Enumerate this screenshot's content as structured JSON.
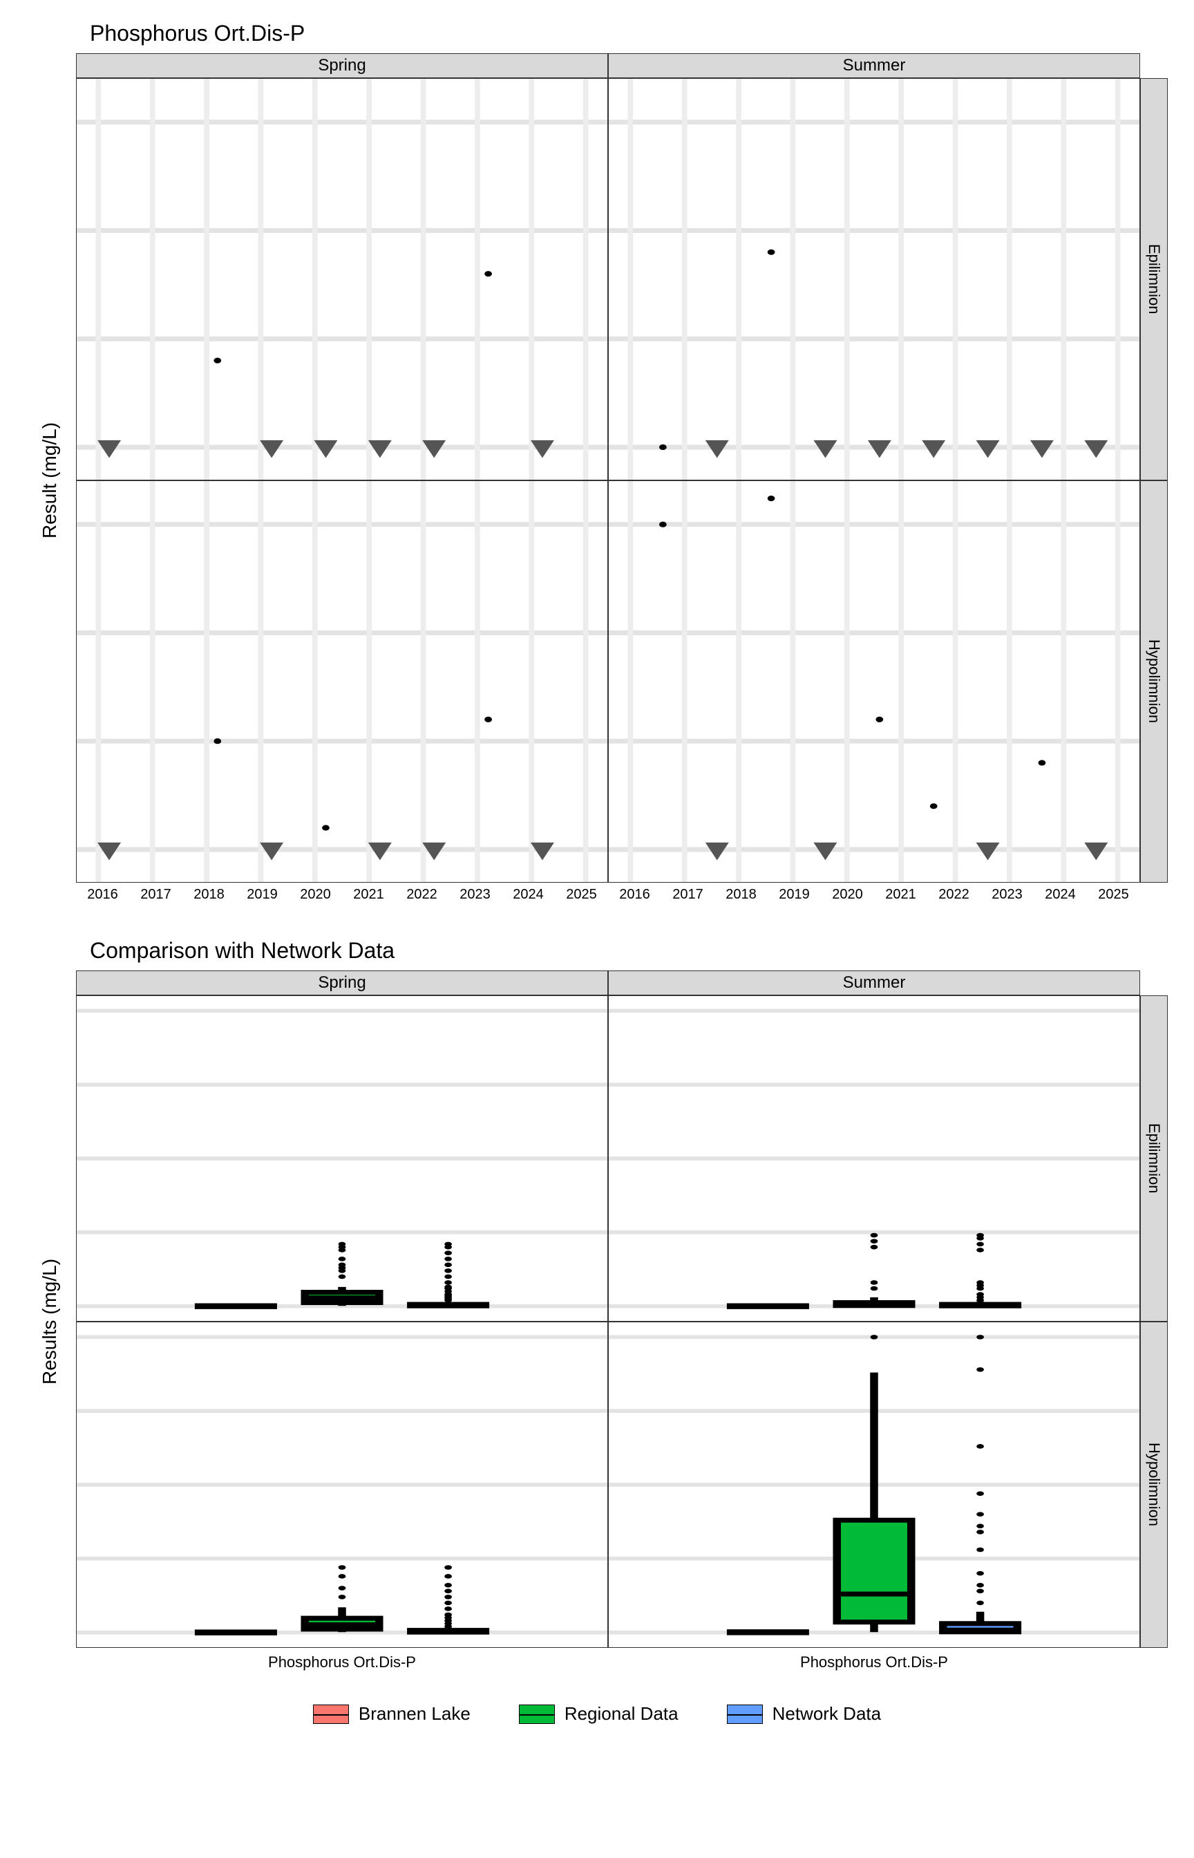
{
  "chart1": {
    "title": "Phosphorus Ort.Dis-P",
    "ylabel": "Result (mg/L)",
    "cols": [
      "Spring",
      "Summer"
    ],
    "rows": [
      "Epilimnion",
      "Hypolimnion"
    ],
    "x_ticks": [
      "2016",
      "2017",
      "2018",
      "2019",
      "2020",
      "2021",
      "2022",
      "2023",
      "2024",
      "2025"
    ],
    "y_ticks": [
      0.001,
      0.0015,
      0.002,
      0.0025
    ],
    "y_range": [
      0.00085,
      0.0027
    ]
  },
  "chart2": {
    "title": "Comparison with Network Data",
    "ylabel": "Results (mg/L)",
    "cols": [
      "Spring",
      "Summer"
    ],
    "rows": [
      "Epilimnion",
      "Hypolimnion"
    ],
    "x_category": "Phosphorus Ort.Dis-P",
    "y_ticks": [
      0.0,
      0.25,
      0.5,
      0.75,
      1.0
    ],
    "y_range": [
      -0.05,
      1.05
    ]
  },
  "legend": {
    "items": [
      {
        "label": "Brannen Lake",
        "color": "#F8766D"
      },
      {
        "label": "Regional Data",
        "color": "#00BA38"
      },
      {
        "label": "Network Data",
        "color": "#619CFF"
      }
    ]
  },
  "chart_data": [
    {
      "type": "scatter",
      "title": "Phosphorus Ort.Dis-P",
      "xlabel": "",
      "ylabel": "Result (mg/L)",
      "ylim": [
        0.00085,
        0.0027
      ],
      "facets_col": [
        "Spring",
        "Summer"
      ],
      "facets_row": [
        "Epilimnion",
        "Hypolimnion"
      ],
      "panels": {
        "Spring|Epilimnion": {
          "dots": [
            {
              "x": 2018.2,
              "y": 0.0014
            },
            {
              "x": 2023.2,
              "y": 0.0018
            }
          ],
          "triangles": [
            {
              "x": 2016.2,
              "y": 0.001
            },
            {
              "x": 2019.2,
              "y": 0.001
            },
            {
              "x": 2020.2,
              "y": 0.001
            },
            {
              "x": 2021.2,
              "y": 0.001
            },
            {
              "x": 2022.2,
              "y": 0.001
            },
            {
              "x": 2024.2,
              "y": 0.001
            }
          ]
        },
        "Summer|Epilimnion": {
          "dots": [
            {
              "x": 2016.6,
              "y": 0.001
            },
            {
              "x": 2018.6,
              "y": 0.0019
            }
          ],
          "triangles": [
            {
              "x": 2017.6,
              "y": 0.001
            },
            {
              "x": 2019.6,
              "y": 0.001
            },
            {
              "x": 2020.6,
              "y": 0.001
            },
            {
              "x": 2021.6,
              "y": 0.001
            },
            {
              "x": 2022.6,
              "y": 0.001
            },
            {
              "x": 2023.6,
              "y": 0.001
            },
            {
              "x": 2024.6,
              "y": 0.001
            }
          ]
        },
        "Spring|Hypolimnion": {
          "dots": [
            {
              "x": 2018.2,
              "y": 0.0015
            },
            {
              "x": 2020.2,
              "y": 0.0011
            },
            {
              "x": 2023.2,
              "y": 0.0016
            }
          ],
          "triangles": [
            {
              "x": 2016.2,
              "y": 0.001
            },
            {
              "x": 2019.2,
              "y": 0.001
            },
            {
              "x": 2021.2,
              "y": 0.001
            },
            {
              "x": 2022.2,
              "y": 0.001
            },
            {
              "x": 2024.2,
              "y": 0.001
            }
          ]
        },
        "Summer|Hypolimnion": {
          "dots": [
            {
              "x": 2016.6,
              "y": 0.0025
            },
            {
              "x": 2018.6,
              "y": 0.00262
            },
            {
              "x": 2020.6,
              "y": 0.0016
            },
            {
              "x": 2021.6,
              "y": 0.0012
            },
            {
              "x": 2023.6,
              "y": 0.0014
            }
          ],
          "triangles": [
            {
              "x": 2017.6,
              "y": 0.001
            },
            {
              "x": 2019.6,
              "y": 0.001
            },
            {
              "x": 2022.6,
              "y": 0.001
            },
            {
              "x": 2024.6,
              "y": 0.001
            }
          ]
        }
      }
    },
    {
      "type": "boxplot",
      "title": "Comparison with Network Data",
      "xlabel": "Phosphorus Ort.Dis-P",
      "ylabel": "Results (mg/L)",
      "ylim": [
        -0.05,
        1.05
      ],
      "facets_col": [
        "Spring",
        "Summer"
      ],
      "facets_row": [
        "Epilimnion",
        "Hypolimnion"
      ],
      "groups": [
        "Brannen Lake",
        "Regional Data",
        "Network Data"
      ],
      "colors": {
        "Brannen Lake": "#F8766D",
        "Regional Data": "#00BA38",
        "Network Data": "#619CFF"
      },
      "panels": {
        "Spring|Epilimnion": {
          "boxes": [
            {
              "group": "Brannen Lake",
              "min": 0.001,
              "q1": 0.001,
              "med": 0.001,
              "q3": 0.0015,
              "max": 0.0018,
              "outliers": []
            },
            {
              "group": "Regional Data",
              "min": 0.001,
              "q1": 0.012,
              "med": 0.028,
              "q3": 0.047,
              "max": 0.065,
              "outliers": [
                0.1,
                0.12,
                0.13,
                0.14,
                0.16,
                0.19,
                0.2,
                0.21
              ]
            },
            {
              "group": "Network Data",
              "min": 0.001,
              "q1": 0.001,
              "med": 0.002,
              "q3": 0.006,
              "max": 0.012,
              "outliers": [
                0.02,
                0.025,
                0.03,
                0.035,
                0.04,
                0.05,
                0.06,
                0.065,
                0.08,
                0.1,
                0.12,
                0.14,
                0.16,
                0.18,
                0.2,
                0.21
              ]
            }
          ]
        },
        "Summer|Epilimnion": {
          "boxes": [
            {
              "group": "Brannen Lake",
              "min": 0.001,
              "q1": 0.001,
              "med": 0.001,
              "q3": 0.0015,
              "max": 0.0019,
              "outliers": []
            },
            {
              "group": "Regional Data",
              "min": 0.001,
              "q1": 0.002,
              "med": 0.006,
              "q3": 0.012,
              "max": 0.03,
              "outliers": [
                0.06,
                0.08,
                0.2,
                0.22,
                0.24
              ]
            },
            {
              "group": "Network Data",
              "min": 0.001,
              "q1": 0.001,
              "med": 0.002,
              "q3": 0.006,
              "max": 0.015,
              "outliers": [
                0.02,
                0.03,
                0.04,
                0.06,
                0.07,
                0.08,
                0.19,
                0.21,
                0.23,
                0.24
              ]
            }
          ]
        },
        "Spring|Hypolimnion": {
          "boxes": [
            {
              "group": "Brannen Lake",
              "min": 0.001,
              "q1": 0.001,
              "med": 0.0012,
              "q3": 0.0015,
              "max": 0.0016,
              "outliers": []
            },
            {
              "group": "Regional Data",
              "min": 0.001,
              "q1": 0.011,
              "med": 0.026,
              "q3": 0.048,
              "max": 0.085,
              "outliers": [
                0.12,
                0.15,
                0.19,
                0.22
              ]
            },
            {
              "group": "Network Data",
              "min": 0.001,
              "q1": 0.001,
              "med": 0.002,
              "q3": 0.007,
              "max": 0.015,
              "outliers": [
                0.02,
                0.03,
                0.04,
                0.05,
                0.06,
                0.08,
                0.1,
                0.12,
                0.14,
                0.16,
                0.19,
                0.22
              ]
            }
          ]
        },
        "Summer|Hypolimnion": {
          "boxes": [
            {
              "group": "Brannen Lake",
              "min": 0.001,
              "q1": 0.0011,
              "med": 0.0015,
              "q3": 0.0022,
              "max": 0.0026,
              "outliers": []
            },
            {
              "group": "Regional Data",
              "min": 0.001,
              "q1": 0.035,
              "med": 0.13,
              "q3": 0.38,
              "max": 0.88,
              "outliers": [
                1.0
              ]
            },
            {
              "group": "Network Data",
              "min": 0.001,
              "q1": 0.002,
              "med": 0.008,
              "q3": 0.03,
              "max": 0.07,
              "outliers": [
                0.1,
                0.14,
                0.16,
                0.2,
                0.28,
                0.34,
                0.36,
                0.4,
                0.47,
                0.63,
                0.89,
                1.0
              ]
            }
          ]
        }
      }
    }
  ]
}
